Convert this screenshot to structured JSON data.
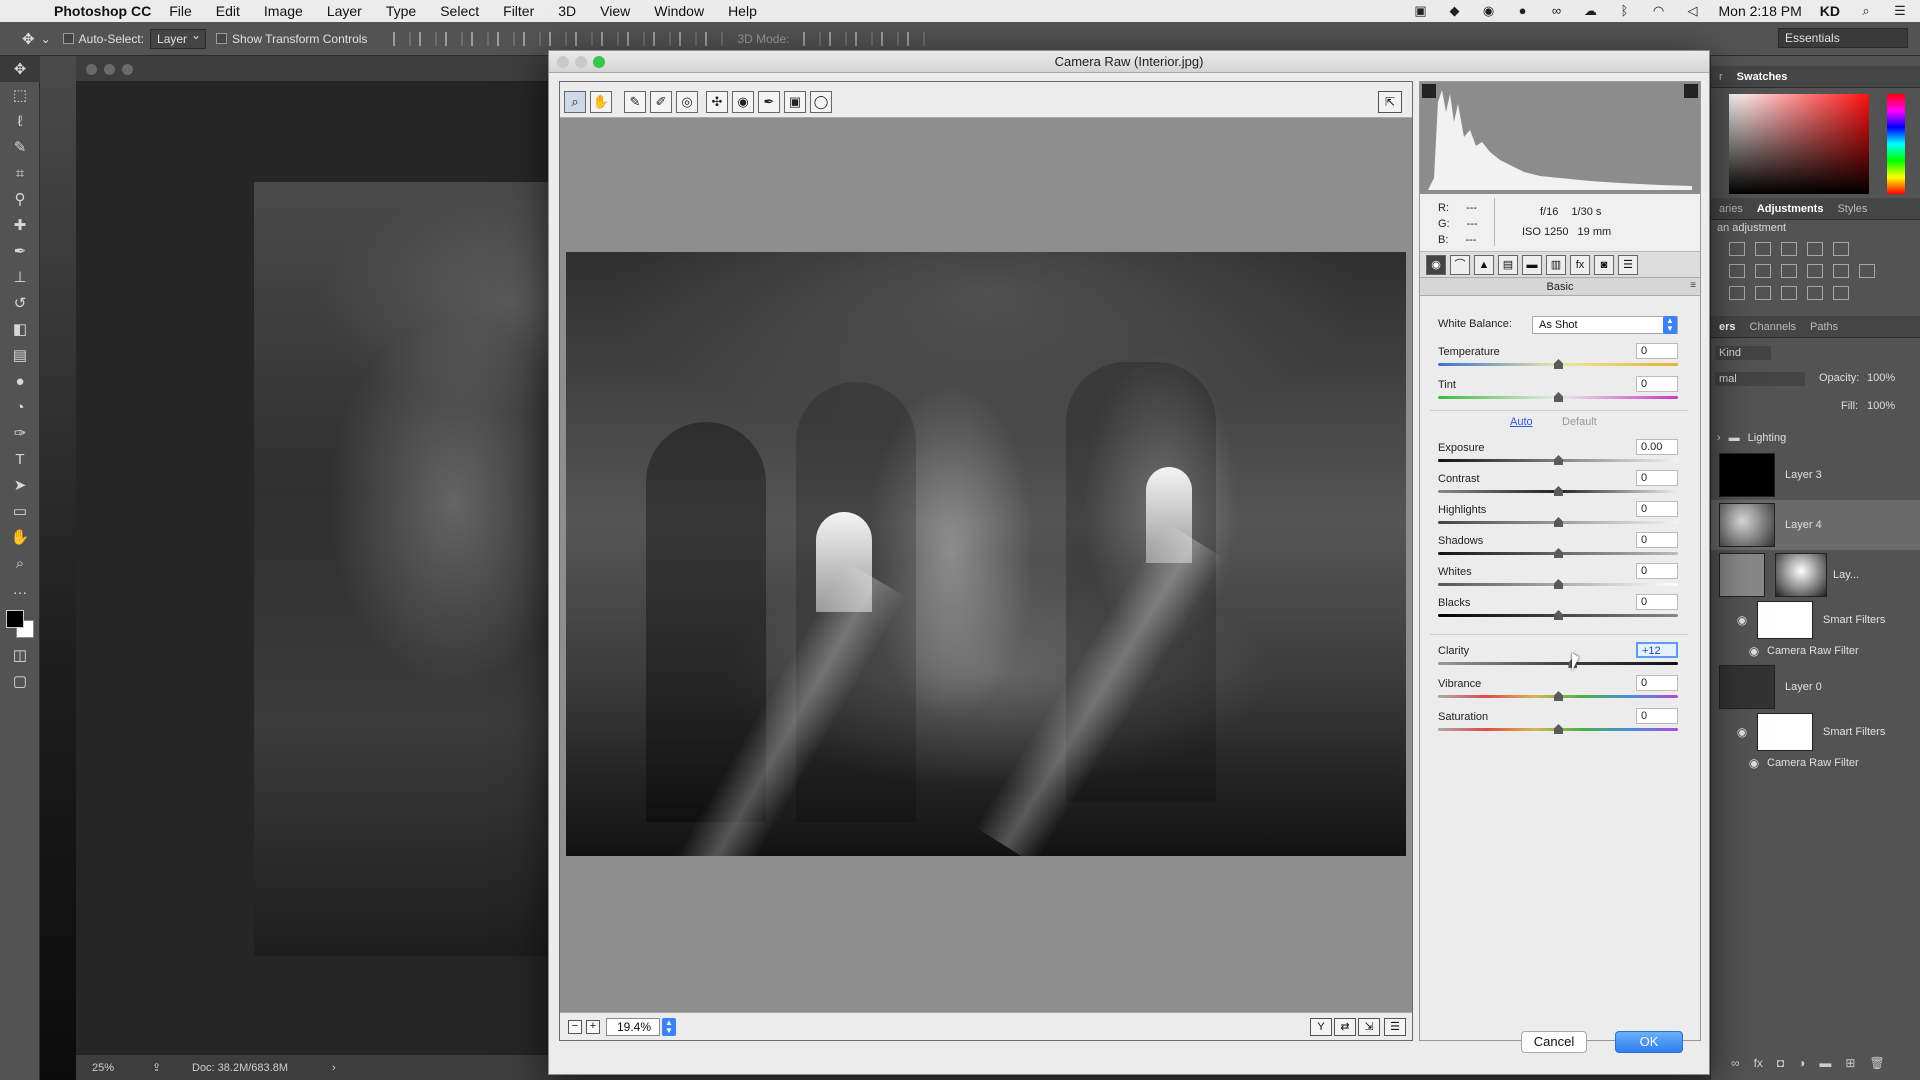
{
  "menubar": {
    "app_name": "Photoshop CC",
    "items": [
      "File",
      "Edit",
      "Image",
      "Layer",
      "Type",
      "Select",
      "Filter",
      "3D",
      "View",
      "Window",
      "Help"
    ],
    "clock": "Mon 2:18 PM",
    "user": "KD",
    "status_icons": [
      "screen-record-icon",
      "dropbox-icon",
      "adobe-cc-icon",
      "chrome-icon",
      "creative-cloud-icon",
      "cloud-icon",
      "bluetooth-icon",
      "wifi-icon",
      "volume-icon"
    ]
  },
  "options_bar": {
    "auto_select_label": "Auto-Select:",
    "auto_select_value": "Layer",
    "transform_label": "Show Transform Controls",
    "mode_3d_label": "3D Mode:",
    "workspace": "Essentials"
  },
  "status_bar": {
    "zoom": "25%",
    "doc_size": "Doc: 38.2M/683.8M"
  },
  "camera_raw": {
    "title": "Camera Raw (Interior.jpg)",
    "zoom": "19.4%",
    "readout": {
      "r_label": "R:",
      "r_value": "---",
      "g_label": "G:",
      "g_value": "---",
      "b_label": "B:",
      "b_value": "---",
      "aperture": "f/16",
      "shutter": "1/30 s",
      "iso": "ISO 1250",
      "focal": "19 mm"
    },
    "panel_title": "Basic",
    "white_balance": {
      "label": "White Balance:",
      "value": "As Shot"
    },
    "auto_link": "Auto",
    "default_link": "Default",
    "sliders": {
      "temperature": {
        "label": "Temperature",
        "value": "0",
        "position": 0.5
      },
      "tint": {
        "label": "Tint",
        "value": "0",
        "position": 0.5
      },
      "exposure": {
        "label": "Exposure",
        "value": "0.00",
        "position": 0.5
      },
      "contrast": {
        "label": "Contrast",
        "value": "0",
        "position": 0.5
      },
      "highlights": {
        "label": "Highlights",
        "value": "0",
        "position": 0.5
      },
      "shadows": {
        "label": "Shadows",
        "value": "0",
        "position": 0.5
      },
      "whites": {
        "label": "Whites",
        "value": "0",
        "position": 0.5
      },
      "blacks": {
        "label": "Blacks",
        "value": "0",
        "position": 0.5
      },
      "clarity": {
        "label": "Clarity",
        "value": "+12",
        "position": 0.56
      },
      "vibrance": {
        "label": "Vibrance",
        "value": "0",
        "position": 0.5
      },
      "saturation": {
        "label": "Saturation",
        "value": "0",
        "position": 0.5
      }
    },
    "buttons": {
      "cancel": "Cancel",
      "ok": "OK"
    },
    "accent_color": "#2f7ff0"
  },
  "panels": {
    "swatches_tab": "Swatches",
    "adjustments_tabs": [
      "aries",
      "Adjustments",
      "Styles"
    ],
    "adjustments_hint": "an adjustment",
    "layers_tabs": [
      "ers",
      "Channels",
      "Paths"
    ],
    "kind_filter": "Kind",
    "blend_mode": "mal",
    "opacity_label": "Opacity:",
    "opacity_value": "100%",
    "fill_label": "Fill:",
    "fill_value": "100%",
    "layers": [
      {
        "name": "Lighting",
        "type": "group"
      },
      {
        "name": "Layer 3",
        "type": "layer"
      },
      {
        "name": "Layer 4",
        "type": "layer",
        "selected": true
      },
      {
        "name": "Lay...",
        "type": "smart"
      },
      {
        "name": "Smart Filters",
        "type": "smart-filters"
      },
      {
        "name": "Camera Raw Filter",
        "type": "filter"
      },
      {
        "name": "Layer 0",
        "type": "smart"
      },
      {
        "name": "Smart Filters",
        "type": "smart-filters"
      },
      {
        "name": "Camera Raw Filter",
        "type": "filter"
      }
    ]
  }
}
